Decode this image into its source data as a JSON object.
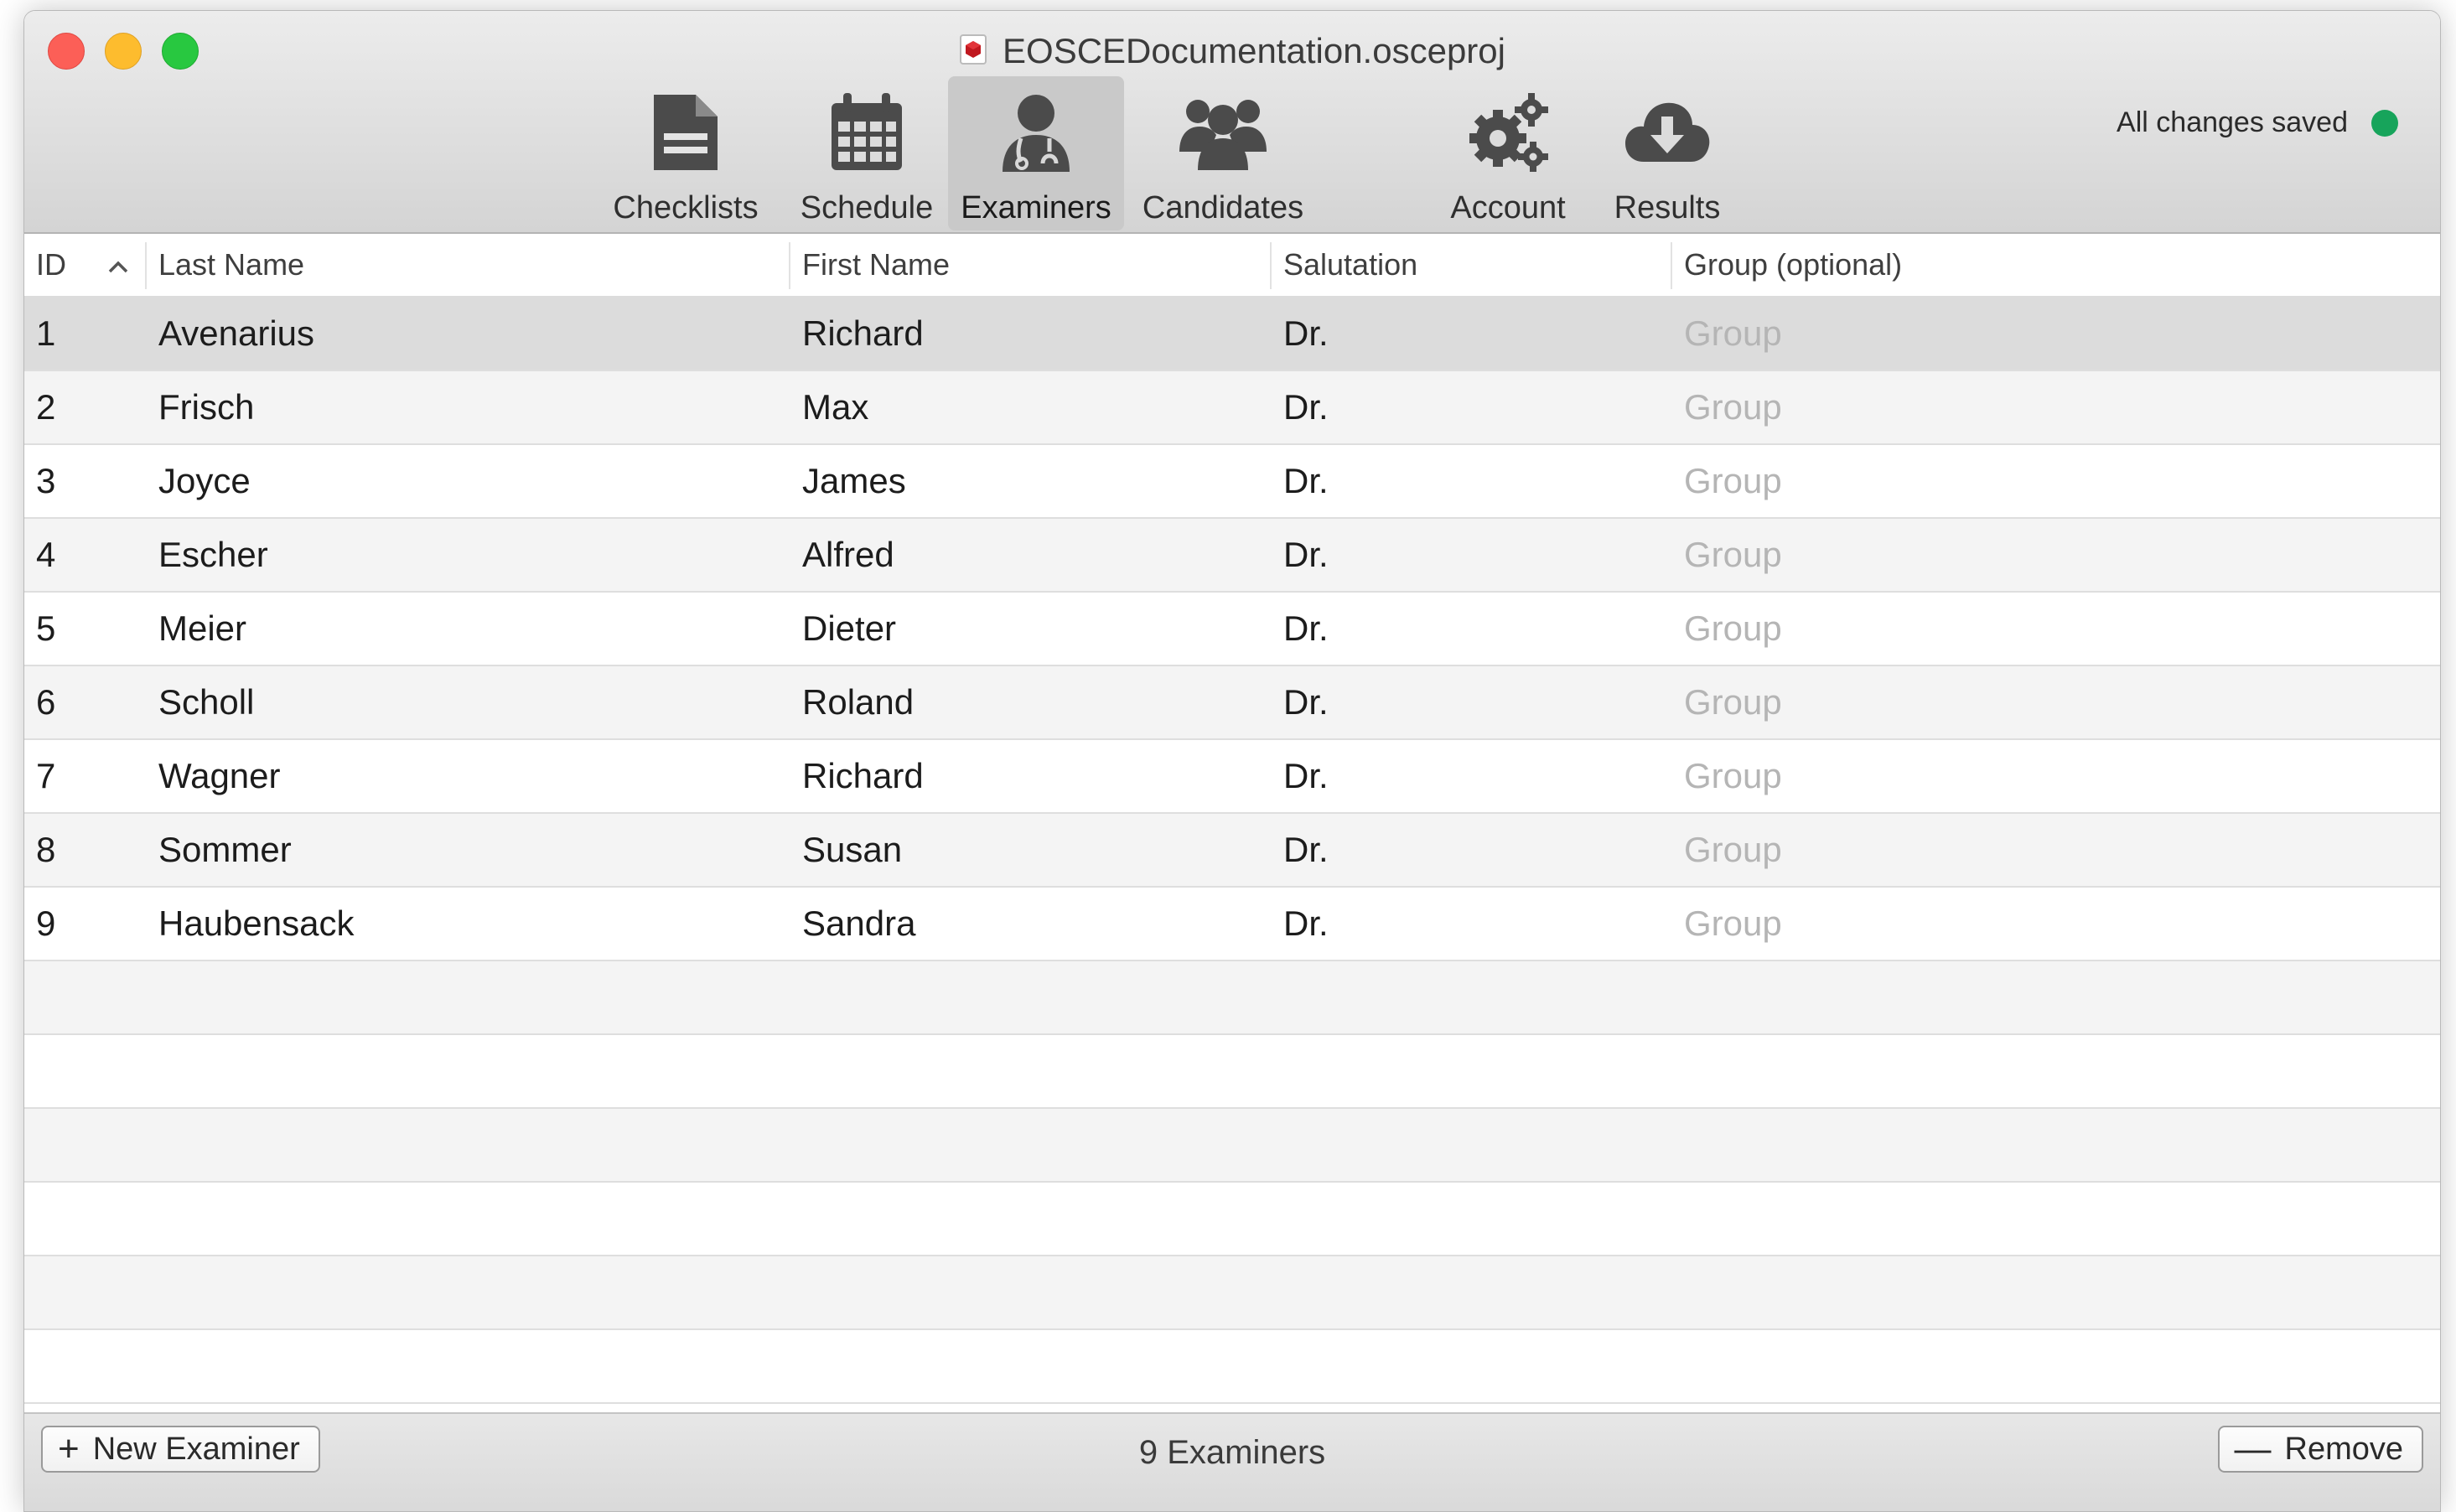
{
  "window": {
    "title": "EOSCEDocumentation.osceproj",
    "status": "All changes saved"
  },
  "toolbar": [
    {
      "id": "checklists",
      "label": "Checklists",
      "icon": "document-icon"
    },
    {
      "id": "schedule",
      "label": "Schedule",
      "icon": "calendar-icon"
    },
    {
      "id": "examiners",
      "label": "Examiners",
      "icon": "doctor-icon",
      "active": true
    },
    {
      "id": "candidates",
      "label": "Candidates",
      "icon": "group-icon"
    },
    {
      "id": "account",
      "label": "Account",
      "icon": "gears-icon"
    },
    {
      "id": "results",
      "label": "Results",
      "icon": "cloud-download-icon"
    }
  ],
  "table": {
    "columns": [
      "ID",
      "Last Name",
      "First Name",
      "Salutation",
      "Group (optional)"
    ],
    "sort_column": "ID",
    "sort_direction": "ascending",
    "group_placeholder": "Group",
    "rows": [
      {
        "id": "1",
        "last": "Avenarius",
        "first": "Richard",
        "salutation": "Dr."
      },
      {
        "id": "2",
        "last": "Frisch",
        "first": "Max",
        "salutation": "Dr."
      },
      {
        "id": "3",
        "last": "Joyce",
        "first": "James",
        "salutation": "Dr."
      },
      {
        "id": "4",
        "last": "Escher",
        "first": "Alfred",
        "salutation": "Dr."
      },
      {
        "id": "5",
        "last": "Meier",
        "first": "Dieter",
        "salutation": "Dr."
      },
      {
        "id": "6",
        "last": "Scholl",
        "first": "Roland",
        "salutation": "Dr."
      },
      {
        "id": "7",
        "last": "Wagner",
        "first": "Richard",
        "salutation": "Dr."
      },
      {
        "id": "8",
        "last": "Sommer",
        "first": "Susan",
        "salutation": "Dr."
      },
      {
        "id": "9",
        "last": "Haubensack",
        "first": "Sandra",
        "salutation": "Dr."
      }
    ]
  },
  "footer": {
    "new_button": "New Examiner",
    "count": "9 Examiners",
    "remove_button": "Remove"
  },
  "colors": {
    "status_dot": "#17a45b",
    "selected_row": "#dcdcdc",
    "placeholder": "#b5b5b5"
  }
}
